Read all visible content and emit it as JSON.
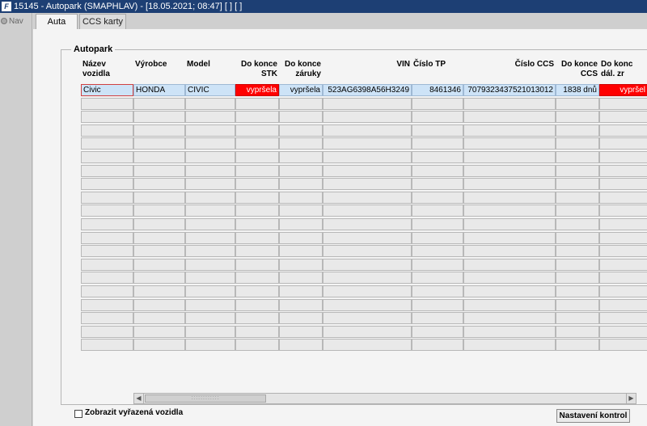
{
  "window": {
    "title": "15145 - Autopark (SMAPHLAV) - [18.05.2021; 08:47]  [ ]  [ ]",
    "app_icon": "app-logo-icon"
  },
  "nav": {
    "label": "Nav",
    "icon": "nav-dot-icon"
  },
  "tabs": [
    {
      "label": "Auta",
      "active": true
    },
    {
      "label": "CCS karty",
      "active": false
    }
  ],
  "group": {
    "title": "Autopark"
  },
  "columns": [
    {
      "line1": "Název",
      "line2": "vozidla"
    },
    {
      "line1": "Výrobce",
      "line2": ""
    },
    {
      "line1": "Model",
      "line2": ""
    },
    {
      "line1": "Do konce",
      "line2": "STK"
    },
    {
      "line1": "Do konce",
      "line2": "záruky"
    },
    {
      "line1": "VIN",
      "line2": ""
    },
    {
      "line1": "Číslo TP",
      "line2": ""
    },
    {
      "line1": "Číslo CCS",
      "line2": ""
    },
    {
      "line1": "Do konce",
      "line2": "CCS"
    },
    {
      "line1": "Do konc",
      "line2": "dál. zr"
    }
  ],
  "rows": [
    [
      "Civic",
      "HONDA",
      "CIVIC",
      "vypršela",
      "vypršela",
      "523AG6398A56H3249",
      "8461346",
      "7079323437521013012",
      "1838 dnů",
      "vypršel"
    ]
  ],
  "empty_row_count": 19,
  "status_colors": {
    "expired": "#ff0000",
    "selected_row": "#cde3f7"
  },
  "footer": {
    "checkbox_label": "Zobrazit vyřazená vozidla",
    "checkbox_checked": false,
    "button_label": "Nastavení kontrol"
  }
}
